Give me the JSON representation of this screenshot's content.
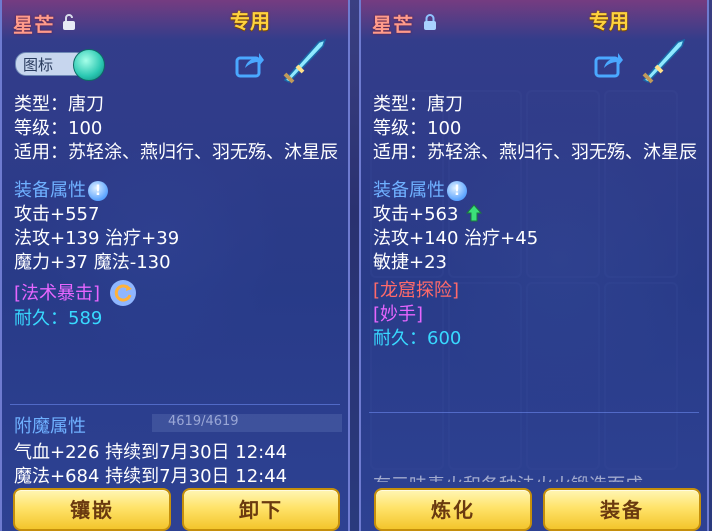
{
  "left_panel": {
    "name": "星芒",
    "exclusive": "专用",
    "icon_toggle_label": "图标",
    "type": "类型：唐刀",
    "level": "等级：100",
    "applies": "适用：苏轻涂、燕归行、羽无殇、沐星辰",
    "attr_header": "装备属性",
    "attack": "攻击+557",
    "mattack_heal": "法攻+139 治疗+39",
    "magic": "魔力+37 魔法-130",
    "skill": "[法术暴击]",
    "durability": "耐久：589",
    "enchant_header": "附魔属性",
    "durability_bar_text": "4619/4619",
    "enchant1": "气血+226 持续到7月30日 12:44",
    "enchant2": "魔法+684 持续到7月30日 12:44",
    "buttons": {
      "inlay": "镶嵌",
      "unequip": "卸下"
    }
  },
  "right_panel": {
    "name": "星芒",
    "exclusive": "专用",
    "type": "类型：唐刀",
    "level": "等级：100",
    "applies": "适用：苏轻涂、燕归行、羽无殇、沐星辰",
    "attr_header": "装备属性",
    "attack": "攻击+563",
    "mattack_heal": "法攻+140 治疗+45",
    "agility": "敏捷+23",
    "special": "[龙窟探险]",
    "skill": "[妙手]",
    "durability": "耐久：600",
    "cut_text": "有三味毒火和各种法火火锻造而成",
    "buttons": {
      "refine": "炼化",
      "equip": "装备"
    }
  },
  "colors": {
    "name": "#ff9b8b",
    "exclusive": "#ffd23e",
    "section": "#6fb0ff",
    "special_red": "#ff6a6a",
    "skill_violet": "#e766ff",
    "durability_cyan": "#38d9ff"
  },
  "icons": {
    "left_lock": "unlocked-padlock-icon",
    "right_lock": "locked-padlock-icon",
    "share": "share-icon",
    "weapon": "sword-icon",
    "info": "info-icon",
    "arrow": "up-arrow-icon",
    "refresh": "refresh-icon"
  }
}
